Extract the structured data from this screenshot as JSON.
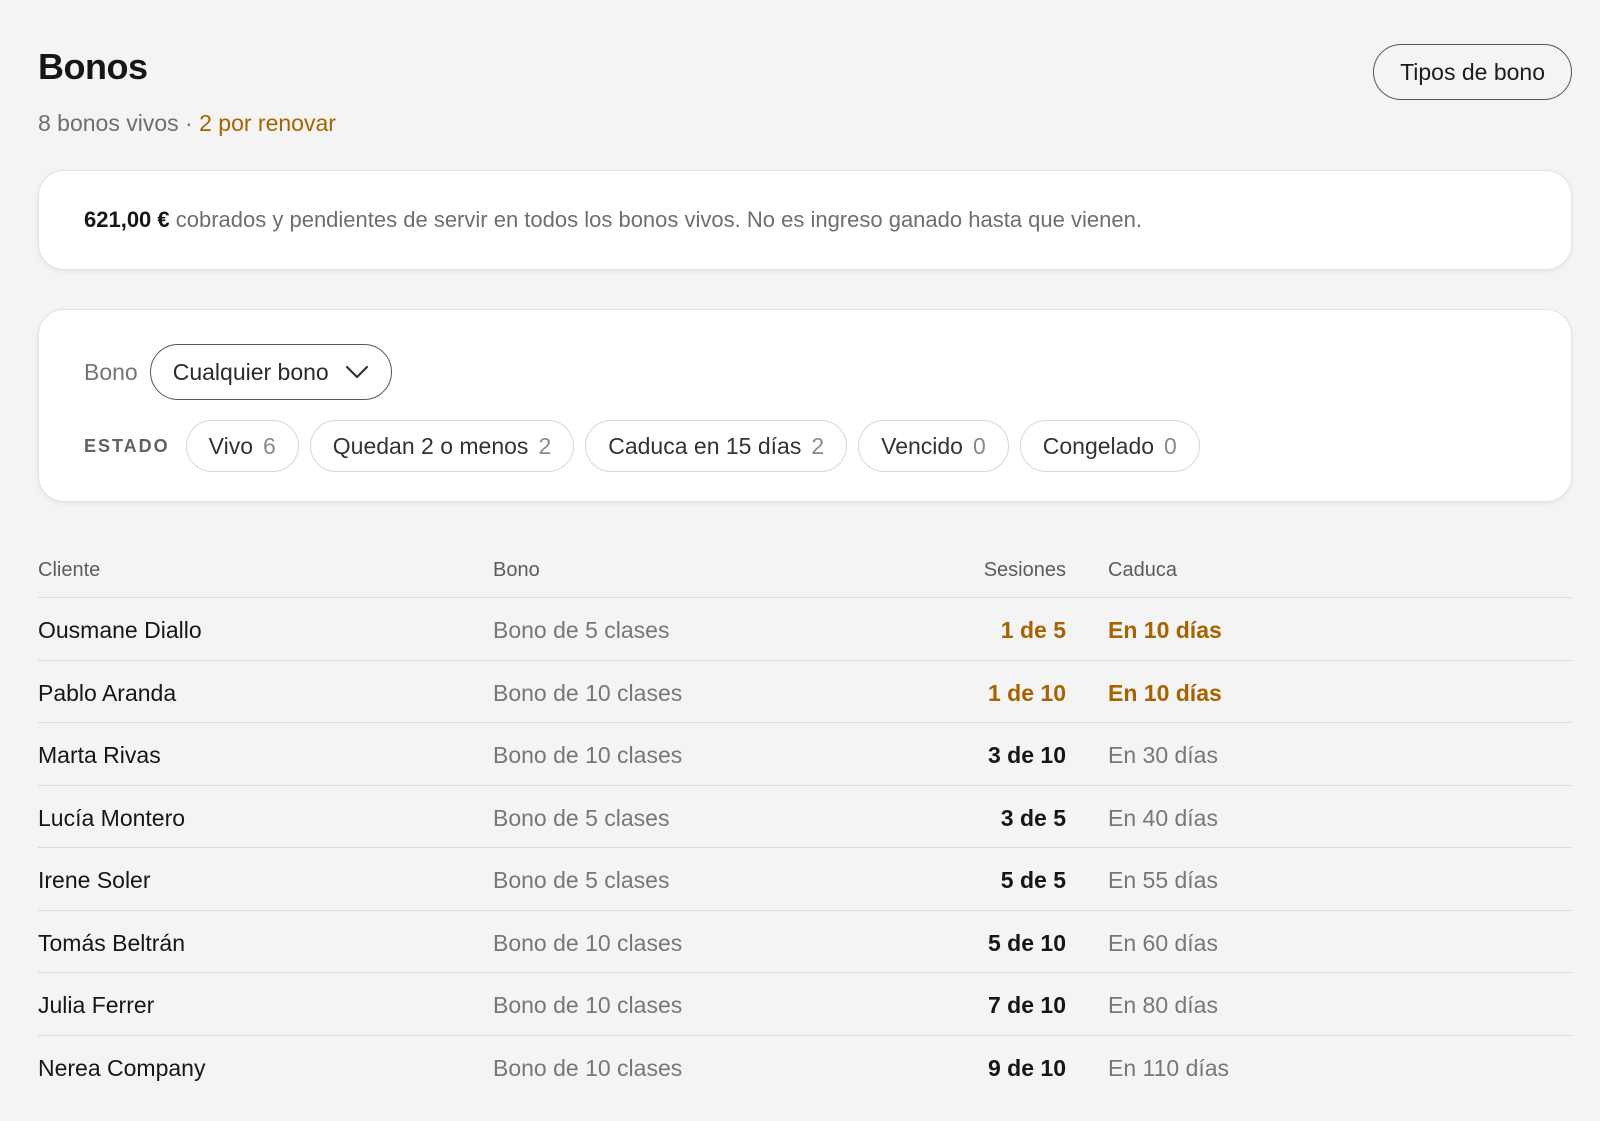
{
  "header": {
    "title": "Bonos",
    "live_count": "8 bonos vivos",
    "separator": " · ",
    "renew_text": "2 por renovar",
    "types_button": "Tipos de bono"
  },
  "info": {
    "amount": "621,00 €",
    "text": " cobrados y pendientes de servir en todos los bonos vivos. No es ingreso ganado hasta que vienen."
  },
  "filters": {
    "bono_label": "Bono",
    "bono_select": "Cualquier bono",
    "estado_label": "ESTADO",
    "chips": [
      {
        "label": "Vivo",
        "count": "6"
      },
      {
        "label": "Quedan 2 o menos",
        "count": "2"
      },
      {
        "label": "Caduca en 15 días",
        "count": "2"
      },
      {
        "label": "Vencido",
        "count": "0"
      },
      {
        "label": "Congelado",
        "count": "0"
      }
    ]
  },
  "table": {
    "headers": {
      "cliente": "Cliente",
      "bono": "Bono",
      "sesiones": "Sesiones",
      "caduca": "Caduca"
    },
    "rows": [
      {
        "cliente": "Ousmane Diallo",
        "bono": "Bono de 5 clases",
        "sesiones": "1 de 5",
        "caduca": "En 10 días",
        "alert": true
      },
      {
        "cliente": "Pablo Aranda",
        "bono": "Bono de 10 clases",
        "sesiones": "1 de 10",
        "caduca": "En 10 días",
        "alert": true
      },
      {
        "cliente": "Marta Rivas",
        "bono": "Bono de 10 clases",
        "sesiones": "3 de 10",
        "caduca": "En 30 días",
        "alert": false
      },
      {
        "cliente": "Lucía Montero",
        "bono": "Bono de 5 clases",
        "sesiones": "3 de 5",
        "caduca": "En 40 días",
        "alert": false
      },
      {
        "cliente": "Irene Soler",
        "bono": "Bono de 5 clases",
        "sesiones": "5 de 5",
        "caduca": "En 55 días",
        "alert": false
      },
      {
        "cliente": "Tomás Beltrán",
        "bono": "Bono de 10 clases",
        "sesiones": "5 de 10",
        "caduca": "En 60 días",
        "alert": false
      },
      {
        "cliente": "Julia Ferrer",
        "bono": "Bono de 10 clases",
        "sesiones": "7 de 10",
        "caduca": "En 80 días",
        "alert": false
      },
      {
        "cliente": "Nerea Company",
        "bono": "Bono de 10 clases",
        "sesiones": "9 de 10",
        "caduca": "En 110 días",
        "alert": false
      }
    ]
  },
  "colors": {
    "accent_warning": "#a86200",
    "background": "#f4f4f4",
    "card": "#ffffff"
  },
  "icons": {
    "select_chevron": "chevron-down-icon"
  }
}
